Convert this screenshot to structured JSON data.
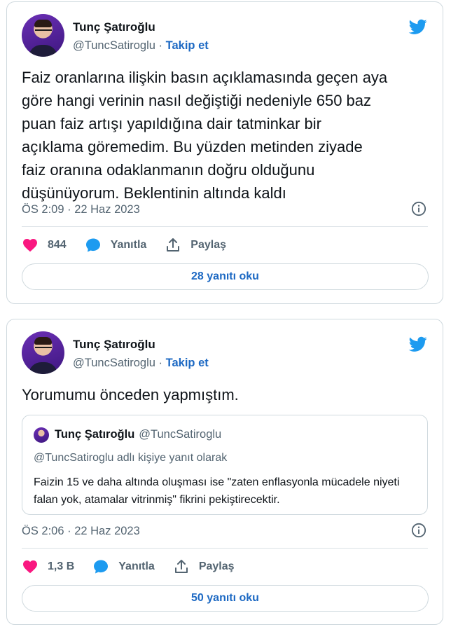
{
  "tweets": [
    {
      "author_name": "Tunç Şatıroğlu",
      "handle": "@TuncSatiroglu",
      "separator": "·",
      "follow_label": "Takip et",
      "text": "Faiz oranlarına ilişkin basın açıklamasında geçen aya\ngöre hangi verinin nasıl değiştiği nedeniyle 650 baz\npuan faiz artışı yapıldığına dair tatminkar bir\naçıklama göremedim. Bu yüzden metinden ziyade\nfaiz oranına odaklanmanın doğru olduğunu\ndüşünüyorum. Beklentinin altında kaldı",
      "timestamp": "ÖS 2:09 · 22 Haz 2023",
      "likes": "844",
      "reply_label": "Yanıtla",
      "share_label": "Paylaş",
      "read_replies": "28 yanıtı oku"
    },
    {
      "author_name": "Tunç Şatıroğlu",
      "handle": "@TuncSatiroglu",
      "separator": "·",
      "follow_label": "Takip et",
      "text": "Yorumumu önceden yapmıştım.",
      "quoted": {
        "author_name": "Tunç Şatıroğlu",
        "handle": "@TuncSatiroglu",
        "reply_context": "@TuncSatiroglu adlı kişiye yanıt olarak",
        "text": "Faizin 15 ve daha altında oluşması ise \"zaten enflasyonla mücadele niyeti falan yok, atamalar vitrinmiş\" fikrini pekiştirecektir."
      },
      "timestamp": "ÖS 2:06 · 22 Haz 2023",
      "likes": "1,3 B",
      "reply_label": "Yanıtla",
      "share_label": "Paylaş",
      "read_replies": "50 yanıtı oku"
    }
  ],
  "icons": {
    "brand": "twitter-bird-icon",
    "like": "heart-icon",
    "reply": "speech-bubble-icon",
    "share": "share-icon",
    "info": "info-icon"
  },
  "colors": {
    "brand_blue": "#1d9bf0",
    "link_blue": "#1d69c3",
    "like_pink": "#f91880",
    "muted_text": "#536471",
    "border": "#cfd9de"
  }
}
